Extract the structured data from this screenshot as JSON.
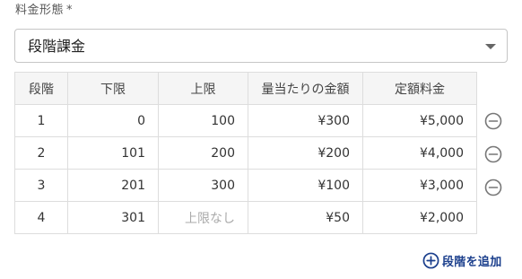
{
  "form": {
    "pricing_label": "料金形態",
    "required_mark": "*",
    "pricing_value": "段階課金"
  },
  "table": {
    "headers": [
      "段階",
      "下限",
      "上限",
      "量当たりの金額",
      "定額料金"
    ],
    "rows": [
      {
        "stage": "1",
        "lower": "0",
        "upper": "100",
        "unit_price": "¥300",
        "fixed_fee": "¥5,000",
        "removable": true
      },
      {
        "stage": "2",
        "lower": "101",
        "upper": "200",
        "unit_price": "¥200",
        "fixed_fee": "¥4,000",
        "removable": true
      },
      {
        "stage": "3",
        "lower": "201",
        "upper": "300",
        "unit_price": "¥100",
        "fixed_fee": "¥3,000",
        "removable": true
      },
      {
        "stage": "4",
        "lower": "301",
        "upper": "上限なし",
        "unit_price": "¥50",
        "fixed_fee": "¥2,000",
        "removable": false
      }
    ]
  },
  "actions": {
    "add_tier_label": "段階を追加"
  },
  "colors": {
    "accent": "#1a3e8c",
    "icon_gray": "#777777",
    "border": "#dddddd",
    "header_bg": "#f5f5f5"
  },
  "icons": {
    "remove": "minus-circle-icon",
    "add": "plus-circle-icon",
    "dropdown": "caret-down-icon"
  }
}
